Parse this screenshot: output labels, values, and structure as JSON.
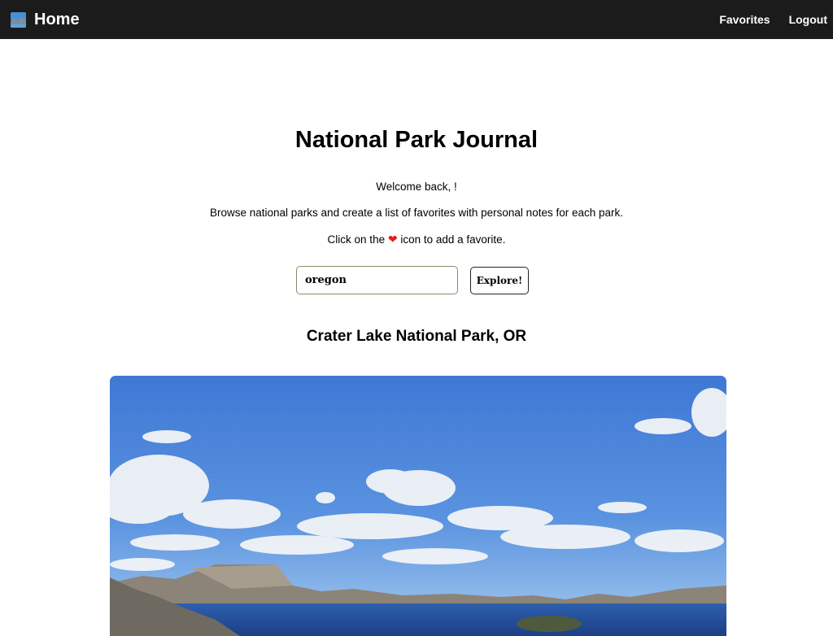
{
  "navbar": {
    "brand_label": "Home",
    "links": [
      "Favorites",
      "Logout"
    ]
  },
  "hero": {
    "title": "National Park Journal",
    "welcome": "Welcome back, !",
    "description": "Browse national parks and create a list of favorites with personal notes for each park.",
    "hint_before": "Click on the",
    "hint_icon": "heart-icon",
    "hint_after": "icon to add a favorite."
  },
  "search": {
    "value": "oregon",
    "button_label": "Explore!"
  },
  "results": [
    {
      "park_name": "Crater Lake National Park, OR",
      "image": "crater-lake-photo"
    }
  ],
  "colors": {
    "navbar_bg": "#1b1b1b",
    "heart": "#e0201c"
  }
}
